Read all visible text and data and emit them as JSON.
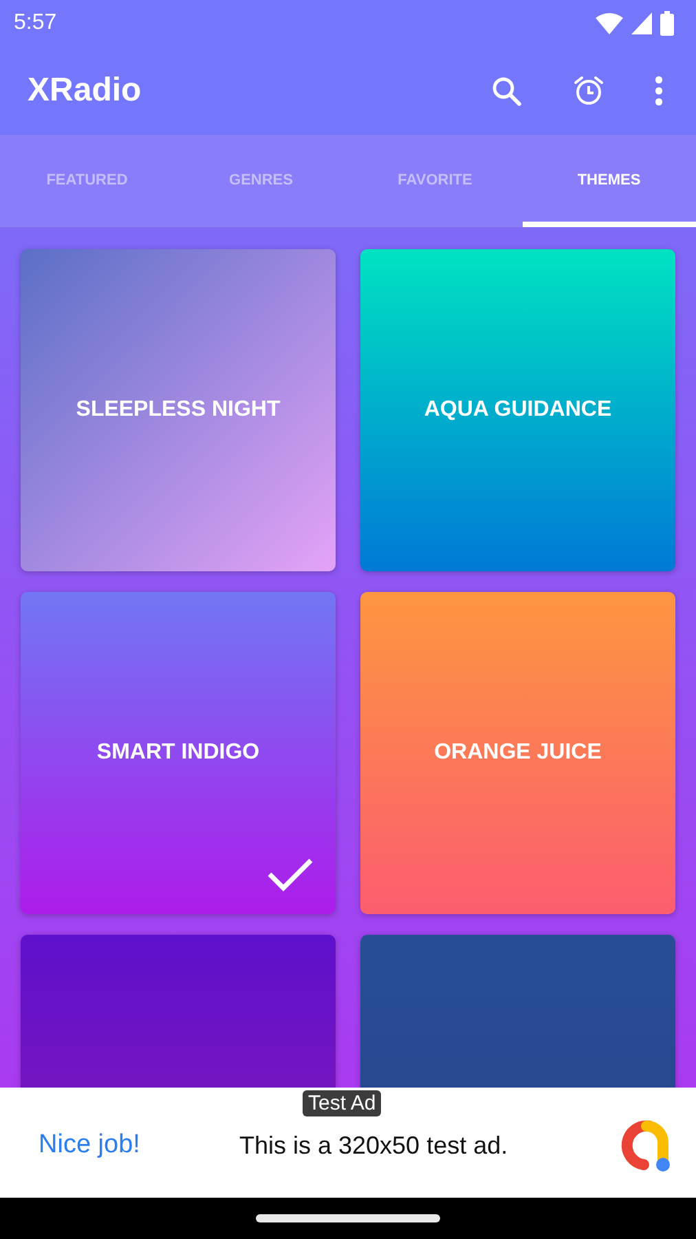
{
  "status_bar": {
    "time": "5:57"
  },
  "app_bar": {
    "title": "XRadio"
  },
  "tabs": [
    {
      "label": "FEATURED",
      "selected": false
    },
    {
      "label": "GENRES",
      "selected": false
    },
    {
      "label": "FAVORITE",
      "selected": false
    },
    {
      "label": "THEMES",
      "selected": true
    }
  ],
  "themes": [
    {
      "name": "SLEEPLESS NIGHT",
      "color": "#5b6fc7",
      "selected": false
    },
    {
      "name": "AQUA GUIDANCE",
      "color": "#00e3c2",
      "selected": false
    },
    {
      "name": "SMART INDIGO",
      "color": "#7277f4",
      "selected": true
    },
    {
      "name": "ORANGE JUICE",
      "color": "#fd9640",
      "selected": false
    },
    {
      "color": "#5e10cc"
    },
    {
      "color": "#284f96"
    }
  ],
  "ad": {
    "badge": "Test Ad",
    "headline": "Nice job!",
    "text": "This is a 320x50 test ad."
  }
}
